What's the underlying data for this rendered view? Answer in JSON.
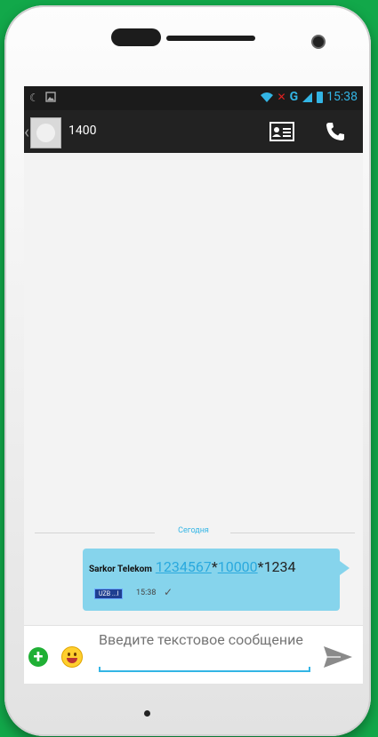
{
  "statusbar": {
    "network_label": "G",
    "time": "15:38",
    "icons": [
      "moon-icon",
      "image-icon",
      "wifi-icon",
      "no-signal-icon",
      "signal-icon",
      "battery-icon"
    ]
  },
  "actionbar": {
    "contact_name": "1400",
    "icons": [
      "back-chevron-icon",
      "avatar",
      "contact-card-icon",
      "phone-icon"
    ]
  },
  "conversation": {
    "date_divider": "Сегодня",
    "messages": [
      {
        "sender": "Sarkor Telekom",
        "parts": [
          {
            "text": "1234567",
            "link": true
          },
          {
            "text": "*",
            "link": false
          },
          {
            "text": "10000",
            "link": true
          },
          {
            "text": "*1234",
            "link": false
          }
        ],
        "sim_label": "UZB ...I",
        "time": "15:38",
        "status_icon": "check-icon"
      }
    ]
  },
  "composer": {
    "placeholder": "Введите текстовое сообщение",
    "icons": [
      "add-icon",
      "emoji-icon",
      "send-icon"
    ]
  },
  "colors": {
    "background_green": "#12a84a",
    "accent_blue": "#33b5e5",
    "bubble": "#86d4ec",
    "actionbar": "#222222"
  }
}
